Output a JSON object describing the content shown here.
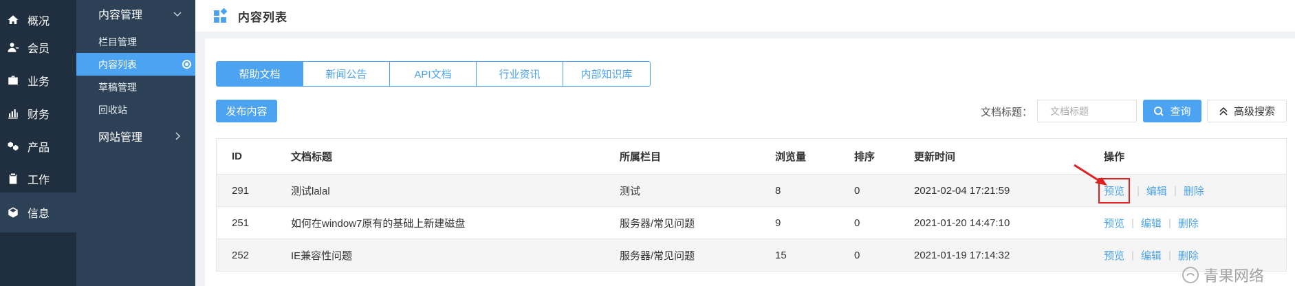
{
  "main_nav": [
    {
      "label": "概况",
      "icon": "home-icon"
    },
    {
      "label": "会员",
      "icon": "user-icon"
    },
    {
      "label": "业务",
      "icon": "briefcase-icon"
    },
    {
      "label": "财务",
      "icon": "finance-chart-icon"
    },
    {
      "label": "产品",
      "icon": "product-cubes-icon"
    },
    {
      "label": "工作",
      "icon": "clipboard-icon"
    },
    {
      "label": "信息",
      "icon": "box-icon"
    }
  ],
  "sub_nav": {
    "group_content": "内容管理",
    "items": [
      "栏目管理",
      "内容列表",
      "草稿管理",
      "回收站"
    ],
    "group_site": "网站管理"
  },
  "page_title": "内容列表",
  "tabs": [
    "帮助文档",
    "新闻公告",
    "API文档",
    "行业资讯",
    "内部知识库"
  ],
  "publish_label": "发布内容",
  "search": {
    "label": "文档标题：",
    "placeholder": "文档标题",
    "query_label": "查询",
    "advanced_label": "高级搜索"
  },
  "table": {
    "headers": {
      "id": "ID",
      "title": "文档标题",
      "category": "所属栏目",
      "views": "浏览量",
      "sort": "排序",
      "updated": "更新时间",
      "ops": "操作"
    },
    "rows": [
      {
        "id": "291",
        "title": "测试lalal",
        "category": "测试",
        "views": "8",
        "sort": "0",
        "updated": "2021-02-04 17:21:59"
      },
      {
        "id": "251",
        "title": "如何在window7原有的基础上新建磁盘",
        "category": "服务器/常见问题",
        "views": "9",
        "sort": "0",
        "updated": "2021-01-20 14:47:10"
      },
      {
        "id": "252",
        "title": "IE兼容性问题",
        "category": "服务器/常见问题",
        "views": "15",
        "sort": "0",
        "updated": "2021-01-19 17:14:32"
      }
    ],
    "op_labels": {
      "preview": "预览",
      "edit": "编辑",
      "delete": "删除",
      "separator": "|"
    }
  },
  "watermark": "青果网络",
  "colors": {
    "accent": "#4ba3f2",
    "sidebar_dark": "#1f2f3f",
    "sidebar_sub": "#2d4156",
    "highlight_red": "#e02020"
  }
}
